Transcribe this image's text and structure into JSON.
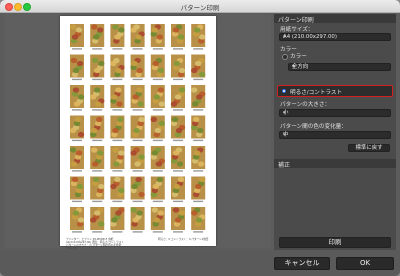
{
  "window": {
    "title": "パターン印刷"
  },
  "preview": {
    "caption_left": "プリンター：エプソン PX-M5081F 用紙：A4(210.00x297.00) 濃度：明るさ/コントラスト パターンの大きさ：小 パターン間の色の変化量：中 補正値：",
    "caption_right": "明るさ：0 コントラスト：0 パターン1枚目"
  },
  "panel": {
    "pattern_section": "パターン印刷",
    "paper_size_label": "用紙サイズ：",
    "paper_size_value": "A4 (210.00x297.00)",
    "color_label": "カラー",
    "color_option_color": "カラー",
    "color_dropdown_value": "全方向",
    "brightness_contrast_label": "明るさ/コントラスト",
    "pattern_size_label": "パターンの大きさ：",
    "pattern_size_value": "小",
    "color_change_label": "パターン間の色の変化量：",
    "color_change_value": "中",
    "reset_button": "標準に戻す",
    "correction_section": "補正",
    "print_button": "印刷"
  },
  "footer": {
    "cancel_button": "キャンセル",
    "ok_button": "OK"
  }
}
